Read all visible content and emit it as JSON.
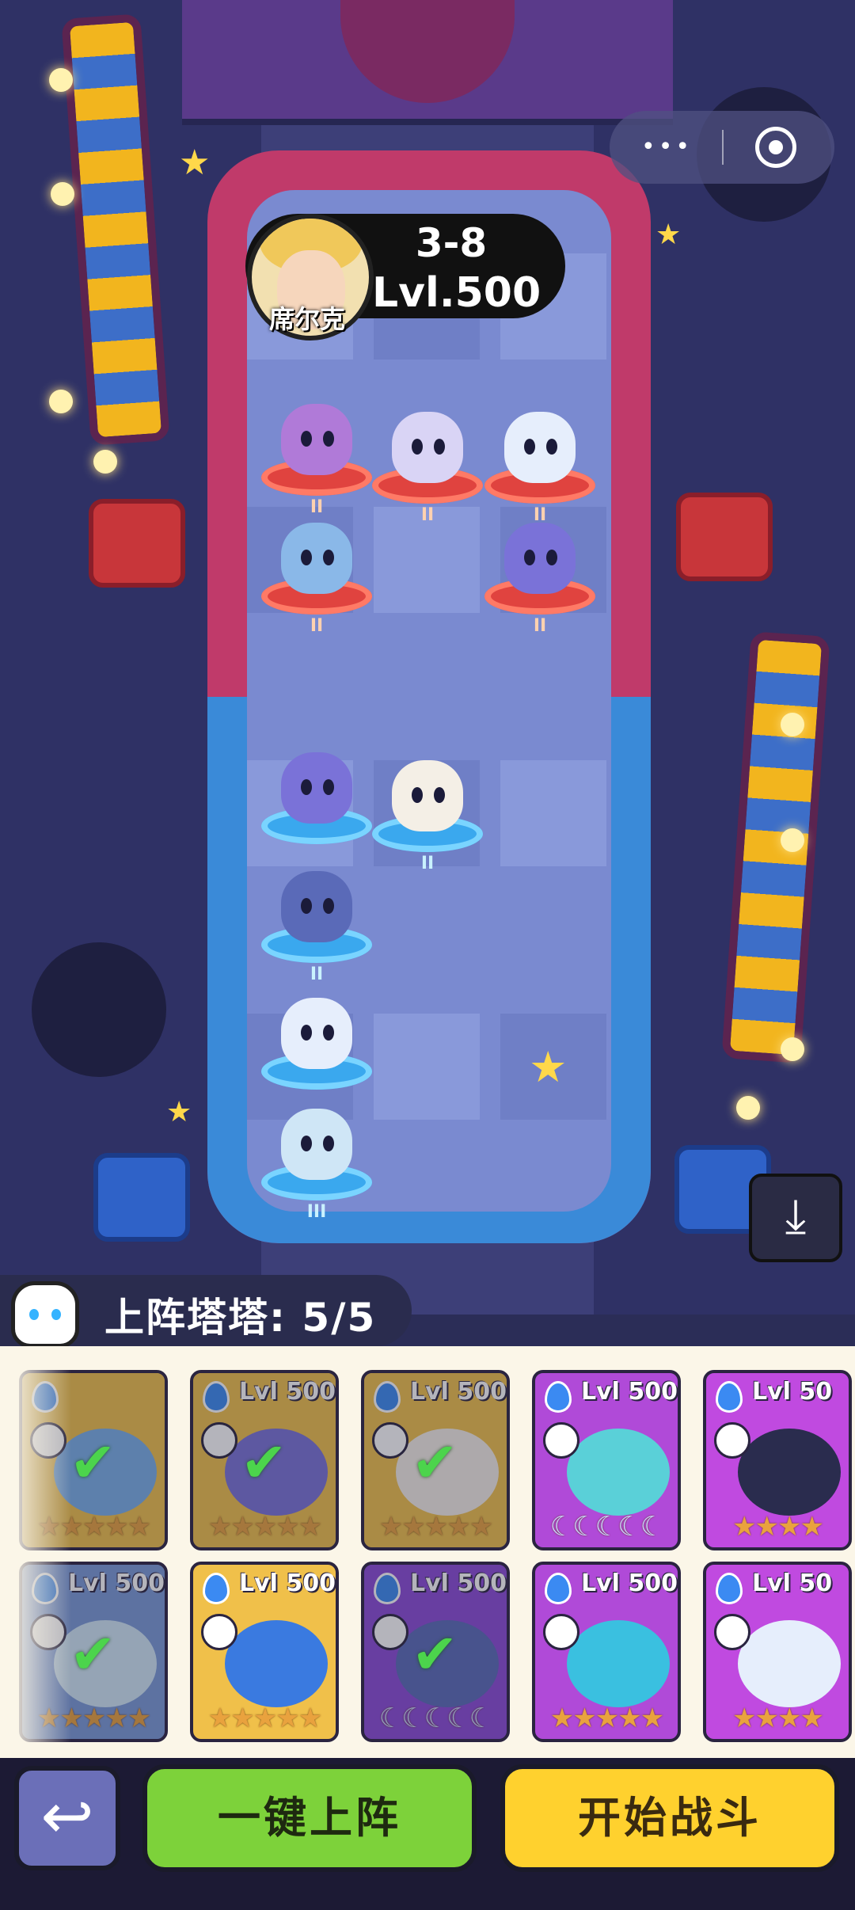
{
  "opponent": {
    "name": "席尔克",
    "stage": "3-8",
    "level": "Lvl.500"
  },
  "team": {
    "label": "上阵塔塔: 5/5"
  },
  "field": {
    "enemy_ranks": [
      "II",
      "II",
      "II",
      "II",
      "II"
    ],
    "ally_ranks": [
      "II",
      "II",
      "III"
    ]
  },
  "cards": [
    {
      "level": "",
      "stars": "★★★★★",
      "selected": true
    },
    {
      "level": "Lvl 500",
      "stars": "★★★★★",
      "selected": true
    },
    {
      "level": "Lvl 500",
      "stars": "★★★★★",
      "selected": true
    },
    {
      "level": "Lvl 500",
      "stars": "☾☾☾☾☾",
      "selected": false
    },
    {
      "level": "Lvl 50",
      "stars": "★★★★",
      "selected": false
    },
    {
      "level": "Lvl 500",
      "stars": "★★★★★",
      "selected": true
    },
    {
      "level": "Lvl 500",
      "stars": "★★★★★",
      "selected": false
    },
    {
      "level": "Lvl 500",
      "stars": "☾☾☾☾☾",
      "selected": true
    },
    {
      "level": "Lvl 500",
      "stars": "★★★★★",
      "selected": false
    },
    {
      "level": "Lvl 50",
      "stars": "★★★★",
      "selected": false
    }
  ],
  "buttons": {
    "auto_deploy": "一键上阵",
    "start_battle": "开始战斗"
  },
  "colors": {
    "auto_deploy": "#7dd23a",
    "start_battle": "#ffd12e",
    "enemy_zone": "#c03a6a",
    "ally_zone": "#3a8ad8"
  }
}
